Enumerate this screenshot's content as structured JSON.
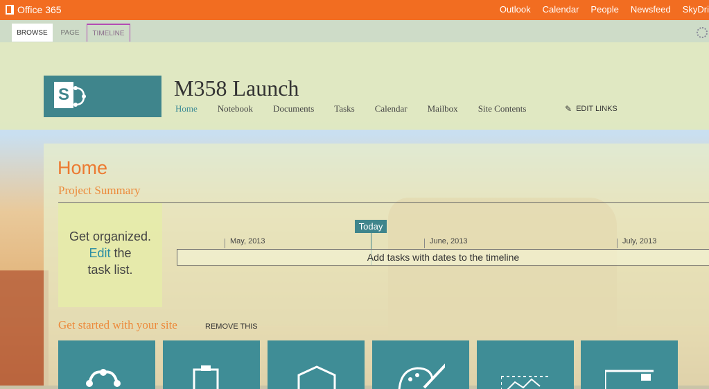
{
  "topbar": {
    "brand": "Office 365",
    "nav": [
      "Outlook",
      "Calendar",
      "People",
      "Newsfeed",
      "SkyDri"
    ]
  },
  "ribbon": {
    "tabs": [
      "BROWSE",
      "PAGE",
      "TIMELINE"
    ]
  },
  "site": {
    "title": "M358 Launch",
    "nav": [
      "Home",
      "Notebook",
      "Documents",
      "Tasks",
      "Calendar",
      "Mailbox",
      "Site Contents"
    ],
    "edit_links": "EDIT LINKS"
  },
  "page": {
    "title": "Home",
    "project_summary": "Project Summary",
    "organized_line1": "Get organized.",
    "organized_edit": "Edit",
    "organized_the": " the",
    "organized_line3": "task list.",
    "today": "Today",
    "months": [
      "May, 2013",
      "June, 2013",
      "July, 2013"
    ],
    "timeline_message": "Add tasks with dates to the timeline",
    "get_started": "Get started with your site",
    "remove_this": "REMOVE THIS"
  },
  "tiles": [
    "share-icon",
    "clipboard-icon",
    "hexagon-icon",
    "palette-icon",
    "image-icon",
    "window-icon"
  ],
  "colors": {
    "office_orange": "#f26d21",
    "teal": "#3f858c",
    "title_orange": "#ec7a31",
    "link_blue": "#2c8fa3"
  }
}
